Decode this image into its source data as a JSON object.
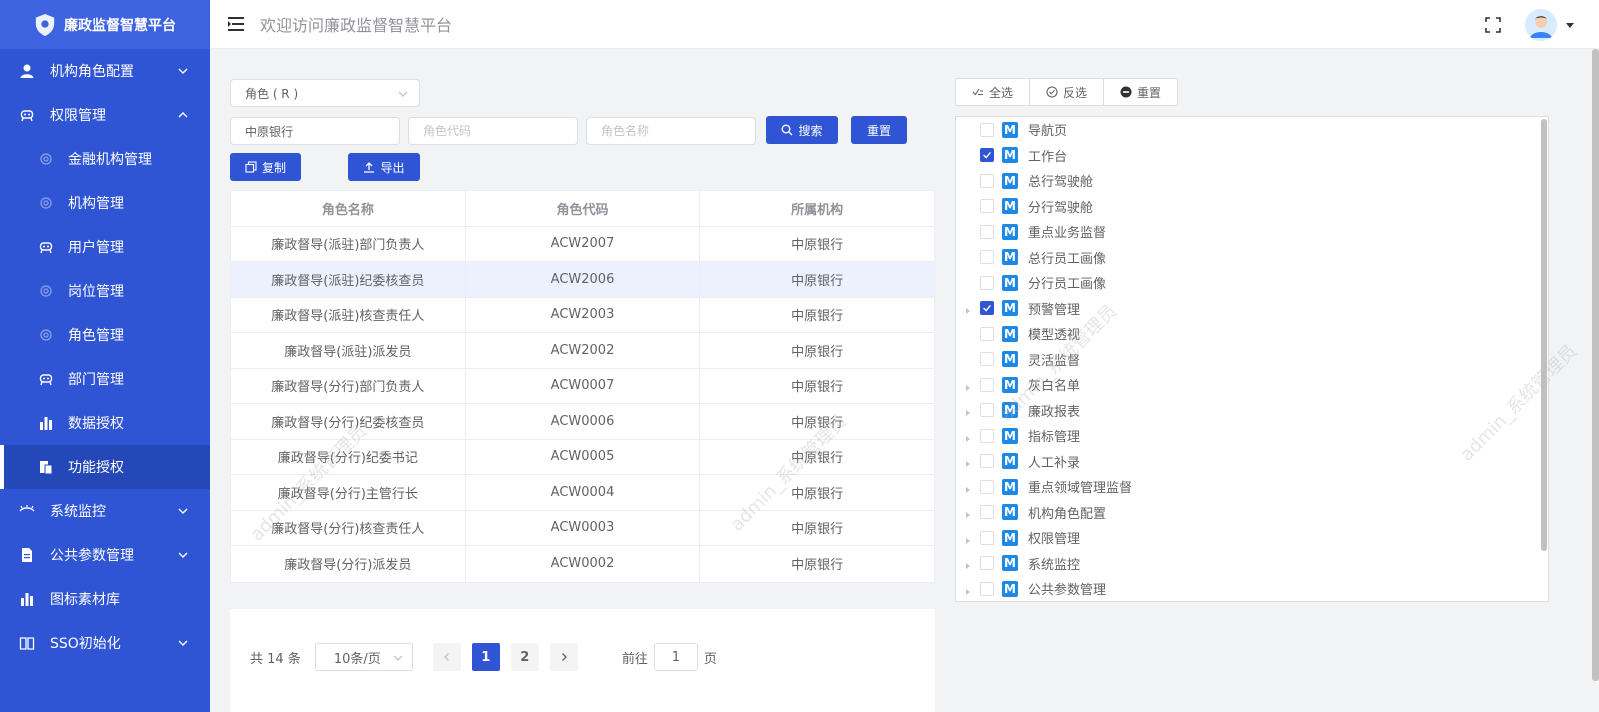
{
  "app": {
    "logo_text": "廉政监督智慧平台",
    "welcome": "欢迎访问廉政监督智慧平台"
  },
  "sidebar": {
    "items": [
      {
        "label": "机构角色配置",
        "icon": "user-icon",
        "expanded": false
      },
      {
        "label": "权限管理",
        "icon": "lock-icon",
        "expanded": true
      },
      {
        "label": "系统监控",
        "icon": "eye-icon",
        "expanded": false
      },
      {
        "label": "公共参数管理",
        "icon": "file-icon",
        "expanded": false
      },
      {
        "label": "图标素材库",
        "icon": "bar-chart-icon"
      },
      {
        "label": "SSO初始化",
        "icon": "book-icon",
        "expanded": false
      }
    ],
    "subitems": [
      {
        "label": "金融机构管理",
        "icon": "gear-icon"
      },
      {
        "label": "机构管理",
        "icon": "gear-icon"
      },
      {
        "label": "用户管理",
        "icon": "lock-icon"
      },
      {
        "label": "岗位管理",
        "icon": "gear-icon"
      },
      {
        "label": "角色管理",
        "icon": "gear-icon"
      },
      {
        "label": "部门管理",
        "icon": "lock-icon"
      },
      {
        "label": "数据授权",
        "icon": "bar-chart-icon"
      },
      {
        "label": "功能授权",
        "icon": "copy-icon",
        "active": true
      }
    ]
  },
  "filters": {
    "role_select": "角色 ( R )",
    "org_input_value": "中原银行",
    "code_placeholder": "角色代码",
    "name_placeholder": "角色名称",
    "search_label": "搜索",
    "reset_label": "重置",
    "copy_label": "复制",
    "export_label": "导出"
  },
  "table": {
    "headers": [
      "角色名称",
      "角色代码",
      "所属机构"
    ],
    "rows": [
      [
        "廉政督导(派驻)部门负责人",
        "ACW2007",
        "中原银行"
      ],
      [
        "廉政督导(派驻)纪委核查员",
        "ACW2006",
        "中原银行"
      ],
      [
        "廉政督导(派驻)核查责任人",
        "ACW2003",
        "中原银行"
      ],
      [
        "廉政督导(派驻)派发员",
        "ACW2002",
        "中原银行"
      ],
      [
        "廉政督导(分行)部门负责人",
        "ACW0007",
        "中原银行"
      ],
      [
        "廉政督导(分行)纪委核查员",
        "ACW0006",
        "中原银行"
      ],
      [
        "廉政督导(分行)纪委书记",
        "ACW0005",
        "中原银行"
      ],
      [
        "廉政督导(分行)主管行长",
        "ACW0004",
        "中原银行"
      ],
      [
        "廉政督导(分行)核查责任人",
        "ACW0003",
        "中原银行"
      ],
      [
        "廉政督导(分行)派发员",
        "ACW0002",
        "中原银行"
      ]
    ],
    "highlighted_row": 1
  },
  "pagination": {
    "total": "共 14 条",
    "page_size": "10条/页",
    "pages": [
      "1",
      "2"
    ],
    "current": "1",
    "goto_prefix": "前往",
    "goto_value": "1",
    "goto_suffix": "页"
  },
  "tree_toolbar": {
    "select_all": "全选",
    "invert": "反选",
    "reset": "重置"
  },
  "tree": {
    "badge": "M",
    "nodes": [
      {
        "label": "导航页",
        "checked": false,
        "expandable": false
      },
      {
        "label": "工作台",
        "checked": true,
        "expandable": false
      },
      {
        "label": "总行驾驶舱",
        "checked": false,
        "expandable": false
      },
      {
        "label": "分行驾驶舱",
        "checked": false,
        "expandable": false
      },
      {
        "label": "重点业务监督",
        "checked": false,
        "expandable": false
      },
      {
        "label": "总行员工画像",
        "checked": false,
        "expandable": false
      },
      {
        "label": "分行员工画像",
        "checked": false,
        "expandable": false
      },
      {
        "label": "预警管理",
        "checked": true,
        "expandable": true
      },
      {
        "label": "模型透视",
        "checked": false,
        "expandable": false
      },
      {
        "label": "灵活监督",
        "checked": false,
        "expandable": false
      },
      {
        "label": "灰白名单",
        "checked": false,
        "expandable": true
      },
      {
        "label": "廉政报表",
        "checked": false,
        "expandable": true
      },
      {
        "label": "指标管理",
        "checked": false,
        "expandable": true
      },
      {
        "label": "人工补录",
        "checked": false,
        "expandable": true
      },
      {
        "label": "重点领域管理监督",
        "checked": false,
        "expandable": true
      },
      {
        "label": "机构角色配置",
        "checked": false,
        "expandable": true
      },
      {
        "label": "权限管理",
        "checked": false,
        "expandable": true
      },
      {
        "label": "系统监控",
        "checked": false,
        "expandable": true
      },
      {
        "label": "公共参数管理",
        "checked": false,
        "expandable": true
      }
    ]
  },
  "watermark": "admin_系统管理员",
  "colors": {
    "primary": "#2f55d4",
    "sidebar": "#2f55d4",
    "badge": "#1e88e5"
  }
}
